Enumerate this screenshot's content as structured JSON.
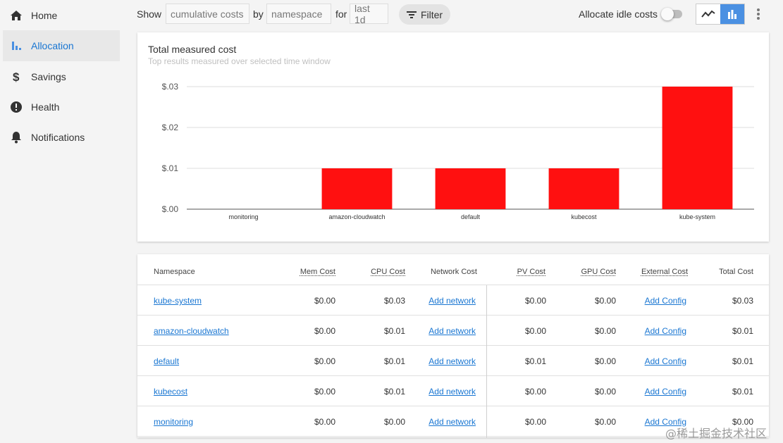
{
  "sidebar": {
    "items": [
      {
        "label": "Home",
        "icon": "home-icon"
      },
      {
        "label": "Allocation",
        "icon": "bar-chart-icon",
        "active": true
      },
      {
        "label": "Savings",
        "icon": "dollar-icon"
      },
      {
        "label": "Health",
        "icon": "alert-circle-icon"
      },
      {
        "label": "Notifications",
        "icon": "bell-icon"
      }
    ]
  },
  "toolbar": {
    "show_label": "Show",
    "aggregate_value": "cumulative costs",
    "by_label": "by",
    "group_value": "namespace",
    "for_label": "for",
    "window_value": "last 1d",
    "filter_label": "Filter",
    "idle_label": "Allocate idle costs",
    "idle_enabled": false
  },
  "chart": {
    "title": "Total measured cost",
    "subtitle": "Top results measured over selected time window"
  },
  "chart_data": {
    "type": "bar",
    "categories": [
      "monitoring",
      "amazon-cloudwatch",
      "default",
      "kubecost",
      "kube-system"
    ],
    "values": [
      0.0,
      0.01,
      0.01,
      0.01,
      0.03
    ],
    "yticks": [
      "$.00",
      "$.01",
      "$.02",
      "$.03"
    ],
    "ylim": [
      0,
      0.03
    ],
    "bar_color": "#ff1010",
    "grid": true
  },
  "table": {
    "headers": {
      "namespace": "Namespace",
      "mem": "Mem Cost",
      "cpu": "CPU Cost",
      "network": "Network Cost",
      "pv": "PV Cost",
      "gpu": "GPU Cost",
      "external": "External Cost",
      "total": "Total Cost"
    },
    "rows": [
      {
        "namespace": "kube-system",
        "mem": "$0.00",
        "cpu": "$0.03",
        "network": "Add network",
        "pv": "$0.00",
        "gpu": "$0.00",
        "external": "Add Config",
        "total": "$0.03"
      },
      {
        "namespace": "amazon-cloudwatch",
        "mem": "$0.00",
        "cpu": "$0.01",
        "network": "Add network",
        "pv": "$0.00",
        "gpu": "$0.00",
        "external": "Add Config",
        "total": "$0.01"
      },
      {
        "namespace": "default",
        "mem": "$0.00",
        "cpu": "$0.01",
        "network": "Add network",
        "pv": "$0.01",
        "gpu": "$0.00",
        "external": "Add Config",
        "total": "$0.01"
      },
      {
        "namespace": "kubecost",
        "mem": "$0.00",
        "cpu": "$0.01",
        "network": "Add network",
        "pv": "$0.00",
        "gpu": "$0.00",
        "external": "Add Config",
        "total": "$0.01"
      },
      {
        "namespace": "monitoring",
        "mem": "$0.00",
        "cpu": "$0.00",
        "network": "Add network",
        "pv": "$0.00",
        "gpu": "$0.00",
        "external": "Add Config",
        "total": "$0.00"
      }
    ]
  },
  "watermark": "@稀土掘金技术社区"
}
